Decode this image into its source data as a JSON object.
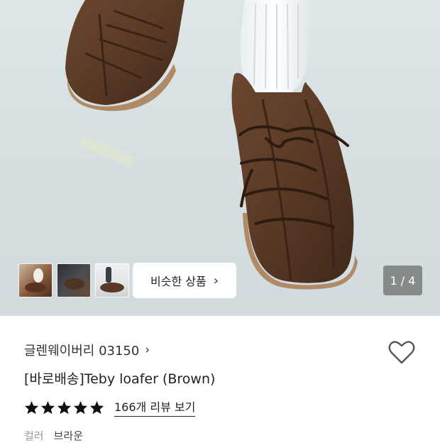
{
  "gallery": {
    "counter": "1 / 4",
    "similar_label": "비슷한 상품",
    "thumbnails": [
      "thumbnail-1",
      "thumbnail-2",
      "thumbnail-3"
    ]
  },
  "product": {
    "brand": "글렌웨이버리 03150",
    "title": "[바로배송]Teby loafer (Brown)",
    "rating": 5,
    "review_link": "166개 리뷰 보기",
    "option_key": "컬러",
    "option_value": "브라운"
  },
  "colors": {
    "star": "#111111",
    "heart_stroke": "#555555",
    "counter_bg": "#6e6e6e"
  }
}
